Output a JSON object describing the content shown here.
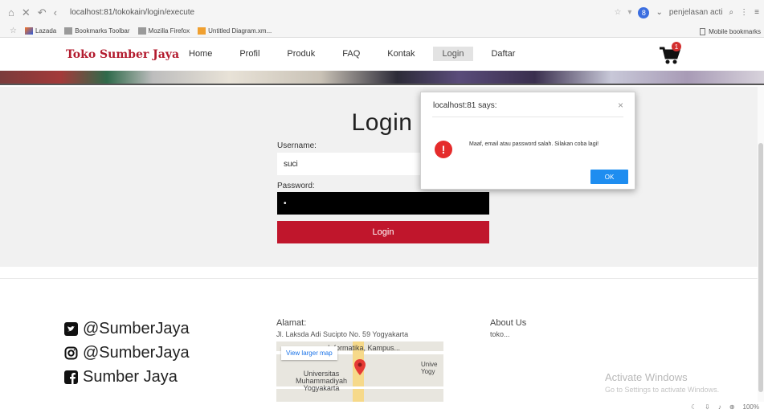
{
  "browser": {
    "url": "localhost:81/tokokain/login/execute",
    "search_text": "penjelasan acti",
    "profile_badge": "8",
    "bookmarks": [
      "Lazada",
      "Bookmarks Toolbar",
      "Mozilla Firefox",
      "Untitled Diagram.xm..."
    ],
    "mobile_bookmarks": "Mobile bookmarks",
    "zoom": "100%"
  },
  "site": {
    "brand": "Toko Sumber Jaya",
    "menu": [
      "Home",
      "Profil",
      "Produk",
      "FAQ",
      "Kontak",
      "Login",
      "Daftar"
    ],
    "active_menu": "Login",
    "cart_count": "1"
  },
  "login": {
    "title": "Login",
    "username_label": "Username:",
    "username_value": "suci",
    "password_label": "Password:",
    "password_value": "•",
    "button_label": "Login"
  },
  "dialog": {
    "title": "localhost:81 says:",
    "close": "×",
    "icon": "!",
    "message": "Maaf, email atau password salah. Silakan coba lagi!",
    "ok_label": "OK",
    "accent_color": "#1e8df0"
  },
  "footer": {
    "social": [
      "@SumberJaya",
      "@SumberJaya",
      "Sumber Jaya"
    ],
    "address_heading": "Alamat:",
    "address_text": "Jl. Laksda Adi Sucipto No. 59 Yogyakarta",
    "map": {
      "view_larger": "View larger map",
      "label_top": "Informatika, Kampus...",
      "label_right": "Unive\nYogy",
      "label_center": "Universitas\nMuhammadiyah\nYogyakarta"
    },
    "about_heading": "About Us",
    "about_text": "toko..."
  },
  "watermark": {
    "title": "Activate Windows",
    "subtitle": "Go to Settings to activate Windows."
  },
  "colors": {
    "brand": "#b31b2e",
    "login_button": "#c0162c",
    "alert_icon": "#e52b2b"
  }
}
